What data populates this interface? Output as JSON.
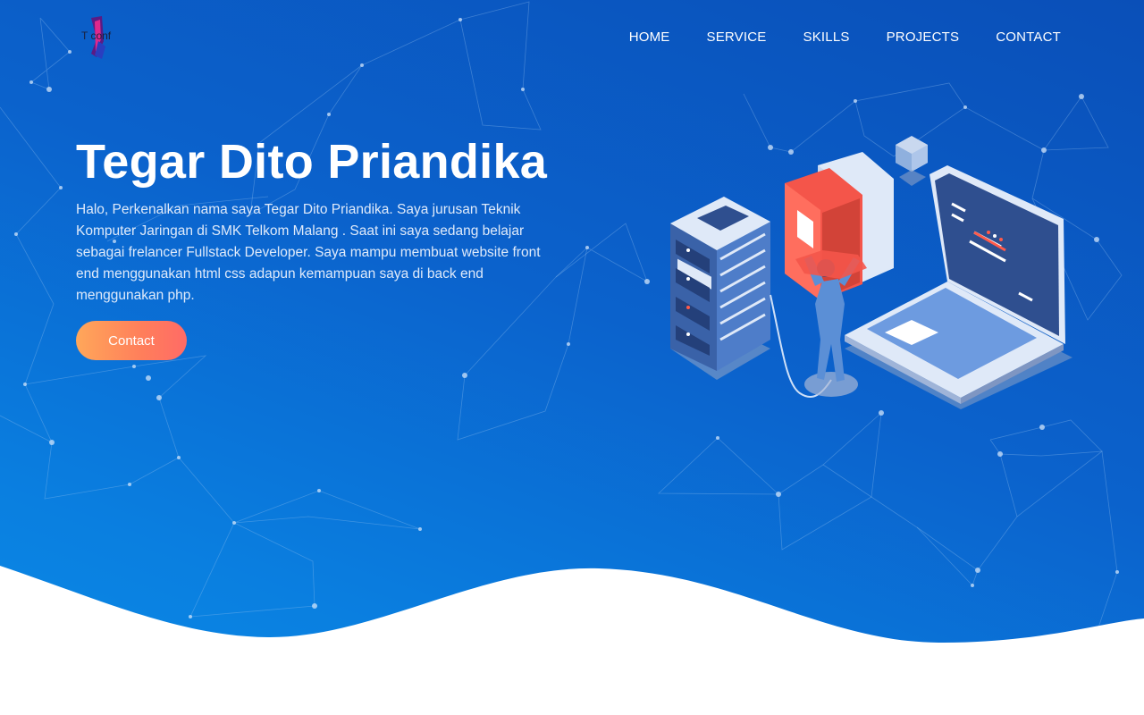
{
  "brand": {
    "logo_text": "T conf"
  },
  "nav": {
    "items": [
      {
        "label": "HOME"
      },
      {
        "label": "SERVICE"
      },
      {
        "label": "SKILLS"
      },
      {
        "label": "PROJECTS"
      },
      {
        "label": "CONTACT"
      }
    ]
  },
  "hero": {
    "title": "Tegar Dito Priandika",
    "bio": "Halo, Perkenalkan nama saya Tegar Dito Priandika. Saya jurusan Teknik Komputer Jaringan di SMK Telkom Malang . Saat ini saya sedang belajar sebagai frelancer Fullstack Developer. Saya mampu membuat website front end menggunakan html css adapun kemampuan saya di back end menggunakan php.",
    "cta_label": "Contact"
  },
  "colors": {
    "hero_blue": "#0b62cc",
    "cta_orange": "#ff8a5a",
    "server_blue": "#5b8fd6",
    "book_red": "#f4554a"
  },
  "icons": [
    "network-background",
    "server-illustration",
    "laptop-illustration",
    "books-illustration"
  ]
}
